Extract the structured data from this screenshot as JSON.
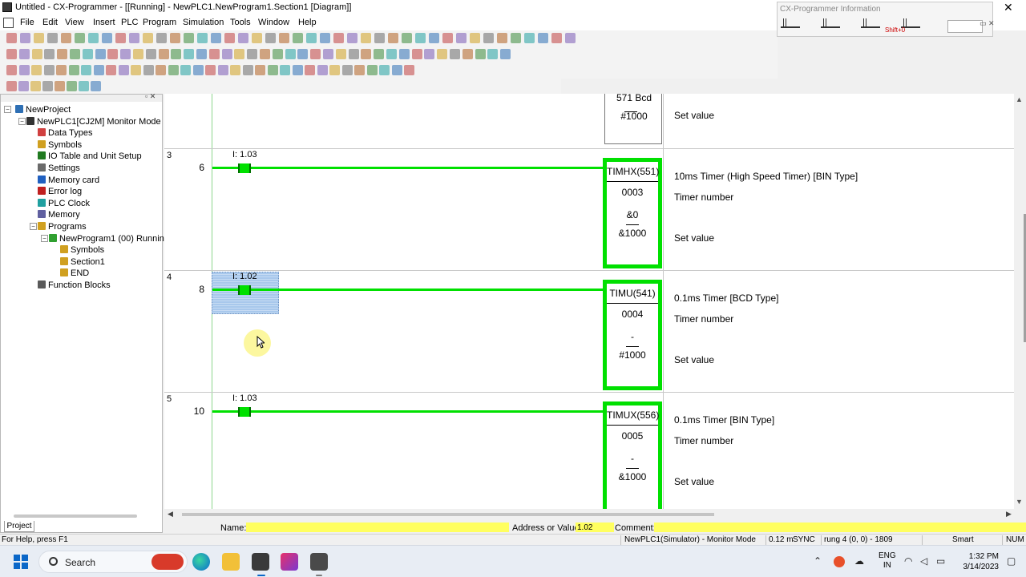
{
  "window": {
    "title": "Untitled - CX-Programmer - [[Running] - NewPLC1.NewProgram1.Section1 [Diagram]]",
    "close_glyph": "✕"
  },
  "menu": [
    "File",
    "Edit",
    "View",
    "Insert",
    "PLC",
    "Program",
    "Simulation",
    "Tools",
    "Window",
    "Help"
  ],
  "info_panel": {
    "title": "CX-Programmer Information",
    "keys": [
      "Next",
      "Previous",
      "Next In/Out",
      "Commented Rung",
      "Jump to Error"
    ],
    "hint": "Shift+0",
    "button": "Information Show/Hide"
  },
  "project_tree": {
    "tab": "Project",
    "items": [
      {
        "label": "NewProject",
        "icon": "project-icon",
        "color": "#2e6fb4"
      },
      {
        "label": "NewPLC1[CJ2M] Monitor Mode",
        "icon": "plc-icon",
        "color": "#333333"
      },
      {
        "label": "Data Types",
        "icon": "data-types-icon",
        "color": "#d04040"
      },
      {
        "label": "Symbols",
        "icon": "symbols-icon",
        "color": "#d0a020"
      },
      {
        "label": "IO Table and Unit Setup",
        "icon": "io-table-icon",
        "color": "#207a20"
      },
      {
        "label": "Settings",
        "icon": "settings-icon",
        "color": "#6a6a6a"
      },
      {
        "label": "Memory card",
        "icon": "memory-card-icon",
        "color": "#2060c0"
      },
      {
        "label": "Error log",
        "icon": "error-log-icon",
        "color": "#c02020"
      },
      {
        "label": "PLC Clock",
        "icon": "clock-icon",
        "color": "#20a0a0"
      },
      {
        "label": "Memory",
        "icon": "memory-icon",
        "color": "#6060a0"
      },
      {
        "label": "Programs",
        "icon": "programs-icon",
        "color": "#d0a020"
      },
      {
        "label": "NewProgram1 (00) Running",
        "icon": "program-icon",
        "color": "#30a030"
      },
      {
        "label": "Symbols",
        "icon": "symbols-icon",
        "color": "#d0a020"
      },
      {
        "label": "Section1",
        "icon": "section-icon",
        "color": "#d0a020"
      },
      {
        "label": "END",
        "icon": "end-section-icon",
        "color": "#d0a020"
      },
      {
        "label": "Function Blocks",
        "icon": "function-blocks-icon",
        "color": "#5a5a5a"
      }
    ]
  },
  "ladder": {
    "top_block": {
      "line1": "571 Bcd",
      "line2": "#1000",
      "desc": "Set value"
    },
    "rungs": [
      {
        "rung": "3",
        "step": "6",
        "contact": "I: 1.03",
        "selected": false,
        "instr": "TIMHX(551)",
        "number": "0003",
        "op2": "&0",
        "setval": "&1000",
        "desc_instr": "10ms Timer (High Speed Timer) [BIN Type]",
        "desc_num": "Timer number",
        "desc_set": "Set value"
      },
      {
        "rung": "4",
        "step": "8",
        "contact": "I: 1.02",
        "selected": true,
        "instr": "TIMU(541)",
        "number": "0004",
        "op2": "-",
        "setval": "#1000",
        "desc_instr": "0.1ms Timer [BCD Type]",
        "desc_num": "Timer number",
        "desc_set": "Set value"
      },
      {
        "rung": "5",
        "step": "10",
        "contact": "I: 1.03",
        "selected": false,
        "instr": "TIMUX(556)",
        "number": "0005",
        "op2": "-",
        "setval": "&1000",
        "desc_instr": "0.1ms Timer [BIN Type]",
        "desc_num": "Timer number",
        "desc_set": "Set value"
      }
    ],
    "energized_color": "#00e000"
  },
  "infobar": {
    "name_label": "Name:",
    "name_value": "",
    "address_label": "Address or Value:",
    "address_value": "1.02",
    "comment_label": "Comment:",
    "comment_value": ""
  },
  "status": {
    "help": "For Help, press F1",
    "plc": "NewPLC1(Simulator) - Monitor Mode",
    "cycle": "0.12 m",
    "sync": "SYNC",
    "position": "rung 4 (0, 0) - 1809",
    "mode": "Smart",
    "num": "NUM"
  },
  "taskbar": {
    "search": "Search",
    "lang_top": "ENG",
    "lang_bottom": "IN",
    "time": "1:32 PM",
    "date": "3/14/2023"
  }
}
